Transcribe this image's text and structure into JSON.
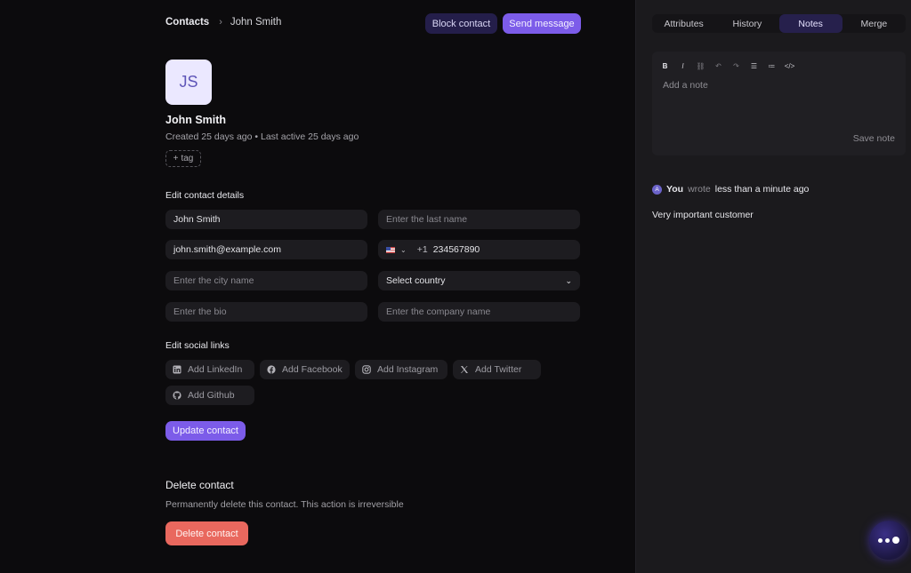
{
  "breadcrumb": {
    "root": "Contacts",
    "separator": "›",
    "current": "John Smith"
  },
  "header": {
    "block_label": "Block contact",
    "send_label": "Send message"
  },
  "contact": {
    "initials": "JS",
    "name": "John Smith",
    "meta": "Created 25 days ago • Last active 25 days ago",
    "tag_label": "tag"
  },
  "edit_details": {
    "title": "Edit contact details",
    "first_name": "John Smith",
    "last_name_placeholder": "Enter the last name",
    "email": "john.smith@example.com",
    "phone_code": "+1",
    "phone_number": "234567890",
    "city_placeholder": "Enter the city name",
    "country_label": "Select country",
    "bio_placeholder": "Enter the bio",
    "company_placeholder": "Enter the company name"
  },
  "social": {
    "title": "Edit social links",
    "items": [
      {
        "label": "Add LinkedIn",
        "icon": "linkedin-icon"
      },
      {
        "label": "Add Facebook",
        "icon": "facebook-icon"
      },
      {
        "label": "Add Instagram",
        "icon": "instagram-icon"
      },
      {
        "label": "Add Twitter",
        "icon": "twitter-icon"
      },
      {
        "label": "Add Github",
        "icon": "github-icon"
      }
    ]
  },
  "update_label": "Update contact",
  "delete": {
    "title": "Delete contact",
    "description": "Permanently delete this contact. This action is irreversible",
    "button_label": "Delete contact"
  },
  "sidebar": {
    "tabs": [
      {
        "label": "Attributes"
      },
      {
        "label": "History"
      },
      {
        "label": "Notes"
      },
      {
        "label": "Merge"
      }
    ],
    "active_tab": "Notes",
    "editor_placeholder": "Add a note",
    "save_label": "Save note",
    "note": {
      "author_initial": "A",
      "author": "You",
      "verb": "wrote",
      "time": "less than a minute ago",
      "body": "Very important customer"
    }
  },
  "colors": {
    "accent": "#7c5ce9",
    "danger": "#e9685e",
    "background": "#0c0b0d",
    "sidebar": "#1b1a1d"
  }
}
